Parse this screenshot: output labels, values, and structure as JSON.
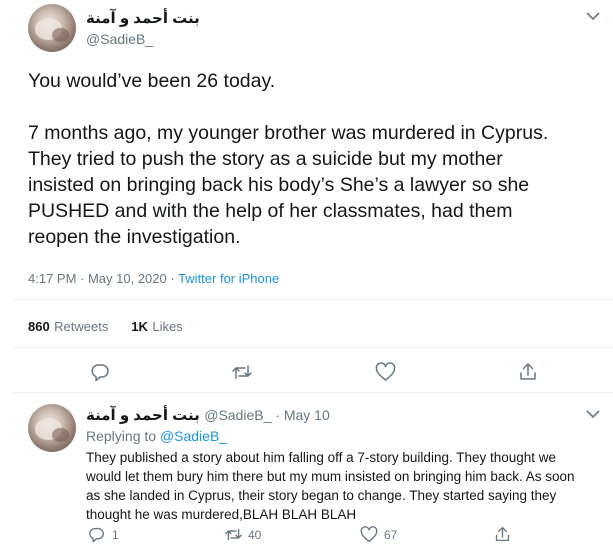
{
  "main_tweet": {
    "author_name": "بنت أحمد و آمنة",
    "handle": "@SadieB_",
    "paragraph1": "You would’ve been 26 today.",
    "lines": [
      "7 months ago, my younger brother was murdered in Cyprus.",
      "They tried to push the story as a suicide but my mother",
      "insisted on bringing back his body’s She’s a lawyer so she",
      "PUSHED and with the help of her classmates, had them",
      "reopen the investigation."
    ],
    "timestamp": "4:17 PM · May 10, 2020 · ",
    "source": "Twitter for iPhone",
    "retweets_count": "860",
    "retweets_label": "Retweets",
    "likes_count": "1K",
    "likes_label": "Likes"
  },
  "reply_tweet": {
    "author_name": "بنت أحمد و آمنة",
    "handle_date": "@SadieB_ · May 10",
    "replying_prefix": "Replying to ",
    "replying_to": "@SadieB_",
    "lines": [
      "They published a story about him falling off a 7-story building. They thought we",
      "would let them bury him there but my mum insisted on bringing him back. As soon",
      "as she landed in Cyprus, their story began to change. They started saying they",
      "thought he was murdered,BLAH BLAH BLAH"
    ],
    "reply_count": "1",
    "retweet_count": "40",
    "like_count": "67"
  },
  "icons": {
    "chevron": "chevron-down-icon",
    "reply": "reply-icon",
    "retweet": "retweet-icon",
    "like": "like-icon",
    "share": "share-icon"
  },
  "colors": {
    "link": "#1b95e0",
    "secondary_text": "#657786",
    "divider": "#e6ecf0"
  }
}
